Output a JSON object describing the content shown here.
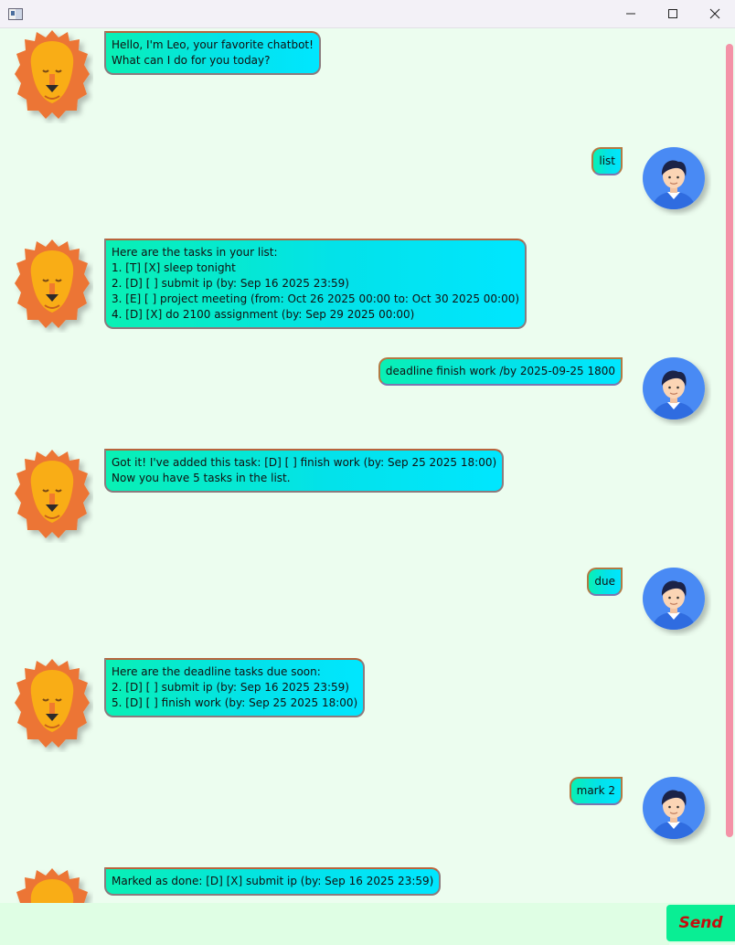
{
  "window": {
    "title": "",
    "controls": [
      "minimize",
      "maximize",
      "close"
    ]
  },
  "messages": [
    {
      "sender": "bot",
      "text": "Hello, I'm Leo, your favorite chatbot!\nWhat can I do for you today?"
    },
    {
      "sender": "user",
      "text": "list"
    },
    {
      "sender": "bot",
      "text": "Here are the tasks in your list:\n1. [T] [X] sleep tonight\n2. [D] [ ] submit ip (by: Sep 16 2025 23:59)\n3. [E] [ ] project meeting (from: Oct 26 2025 00:00 to: Oct 30 2025 00:00)\n4. [D] [X] do 2100 assignment (by: Sep 29 2025 00:00)"
    },
    {
      "sender": "user",
      "text": "deadline finish work /by 2025-09-25 1800"
    },
    {
      "sender": "bot",
      "text": "Got it! I've added this task: [D] [ ] finish work (by: Sep 25 2025 18:00)\nNow you have 5 tasks in the list."
    },
    {
      "sender": "user",
      "text": "due"
    },
    {
      "sender": "bot",
      "text": "Here are the deadline tasks due soon:\n2. [D] [ ] submit ip (by: Sep 16 2025 23:59)\n5. [D] [ ] finish work (by: Sep 25 2025 18:00)"
    },
    {
      "sender": "user",
      "text": "mark 2"
    },
    {
      "sender": "bot",
      "text": "Marked as done: [D] [X] submit ip (by: Sep 16 2025 23:59)"
    }
  ],
  "input": {
    "value": "",
    "placeholder": ""
  },
  "send_button": {
    "label": "Send"
  },
  "colors": {
    "background": "#ecfdef",
    "bubble_gradient_start": "#09f0b4",
    "bubble_gradient_end": "#00e6ff",
    "send_button_bg": "#09ee94",
    "send_button_text": "#c40e0e",
    "scrollbar_thumb": "#f492a7"
  },
  "icons": {
    "bot_avatar": "lion-icon",
    "user_avatar": "user-icon"
  }
}
